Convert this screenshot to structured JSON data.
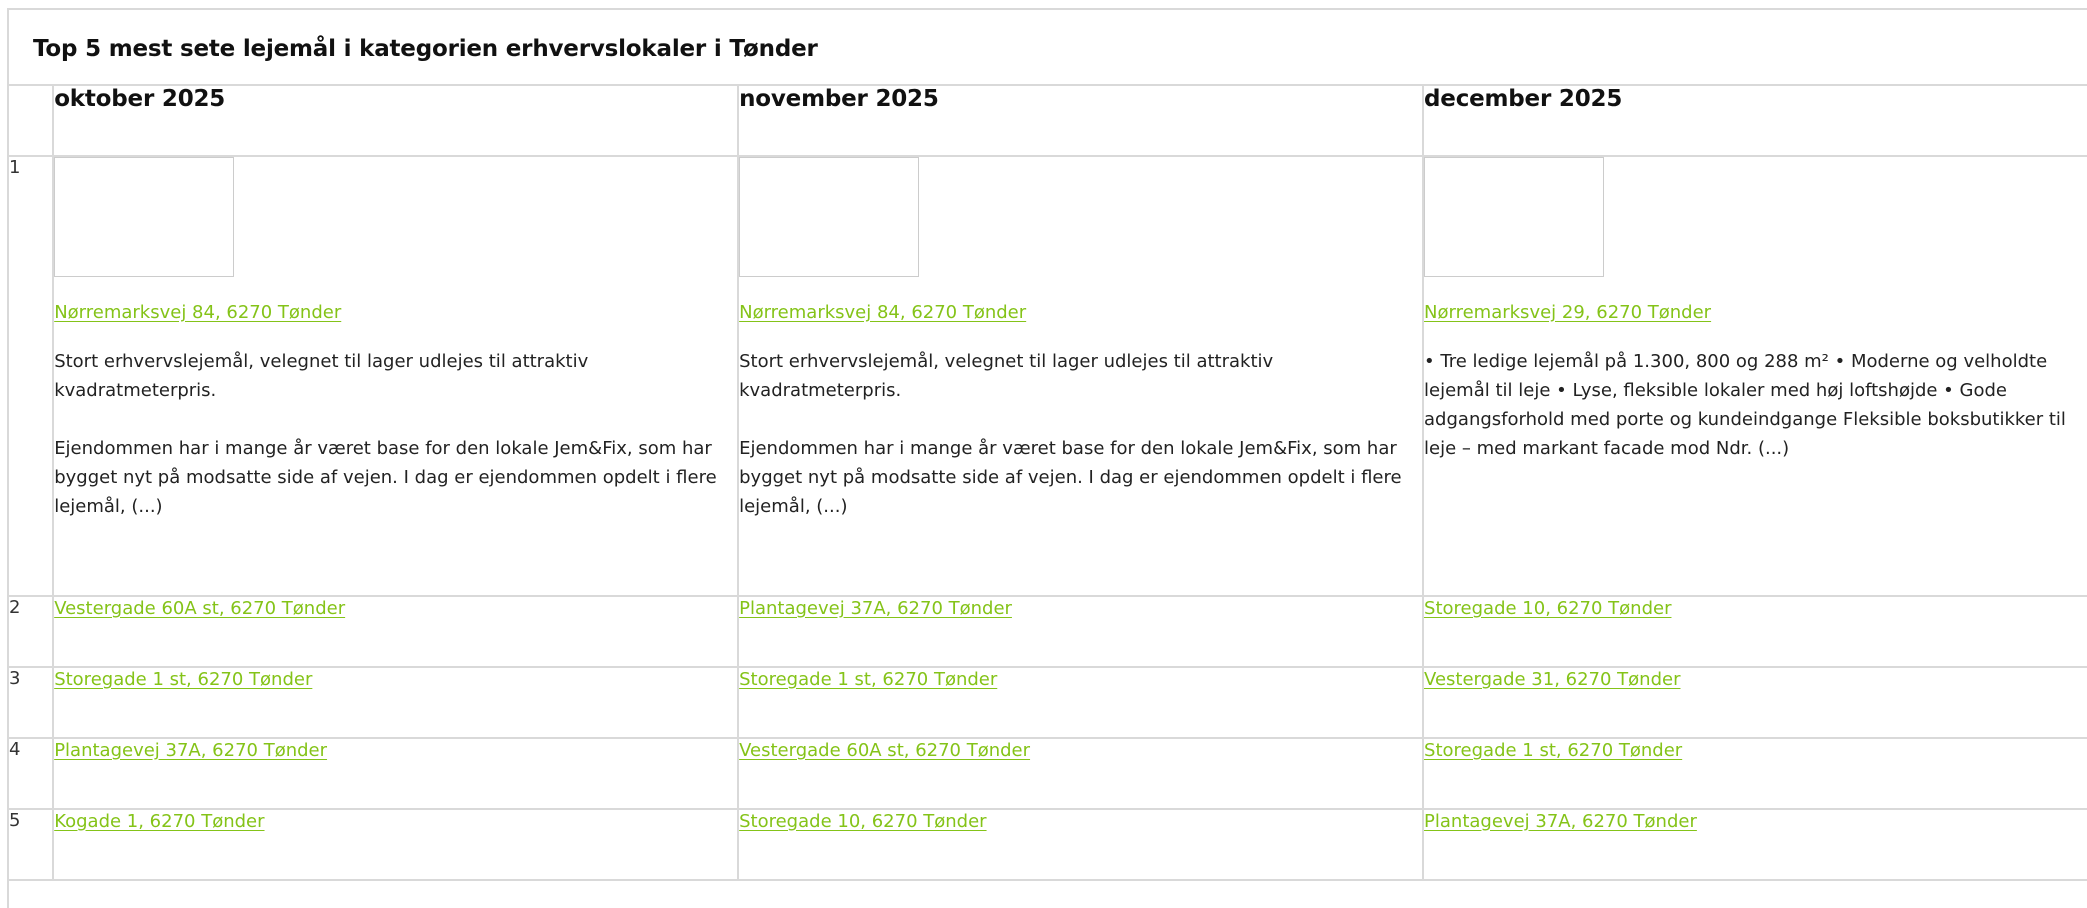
{
  "title": "Top 5 mest sete lejemål i kategorien erhvervslokaler i Tønder",
  "colors": {
    "link": "#84c318",
    "border": "#d9d9d9",
    "text": "#222222"
  },
  "months": [
    "oktober 2025",
    "november 2025",
    "december 2025"
  ],
  "featured": [
    {
      "address": "Nørremarksvej 84, 6270 Tønder",
      "paragraphs": [
        "Stort erhvervslejemål, velegnet til lager udlejes til attraktiv kvadratmeterpris.",
        "Ejendommen har i mange år været base for den lokale Jem&Fix, som har bygget nyt på modsatte side af vejen. I dag er ejendommen opdelt i flere lejemål, (...)"
      ]
    },
    {
      "address": "Nørremarksvej 84, 6270 Tønder",
      "paragraphs": [
        "Stort erhvervslejemål, velegnet til lager udlejes til attraktiv kvadratmeterpris.",
        "Ejendommen har i mange år været base for den lokale Jem&Fix, som har bygget nyt på modsatte side af vejen. I dag er ejendommen opdelt i flere lejemål, (...)"
      ]
    },
    {
      "address": "Nørremarksvej 29, 6270 Tønder",
      "paragraphs": [
        "• Tre ledige lejemål på 1.300, 800 og 288 m² • Moderne og velholdte lejemål til leje • Lyse, fleksible lokaler med høj loftshøjde • Gode adgangsforhold med porte og kundeindgange Fleksible boksbutikker til leje – med markant facade mod Ndr. (...)"
      ]
    }
  ],
  "rows": [
    {
      "rank": "2",
      "addresses": [
        "Vestergade 60A st, 6270 Tønder",
        "Plantagevej 37A, 6270 Tønder",
        "Storegade 10, 6270 Tønder"
      ]
    },
    {
      "rank": "3",
      "addresses": [
        "Storegade 1 st, 6270 Tønder",
        "Storegade 1 st, 6270 Tønder",
        "Vestergade 31, 6270 Tønder"
      ]
    },
    {
      "rank": "4",
      "addresses": [
        "Plantagevej 37A, 6270 Tønder",
        "Vestergade 60A st, 6270 Tønder",
        "Storegade 1 st, 6270 Tønder"
      ]
    },
    {
      "rank": "5",
      "addresses": [
        "Kogade 1, 6270 Tønder",
        "Storegade 10, 6270 Tønder",
        "Plantagevej 37A, 6270 Tønder"
      ]
    }
  ],
  "first_rank": "1"
}
